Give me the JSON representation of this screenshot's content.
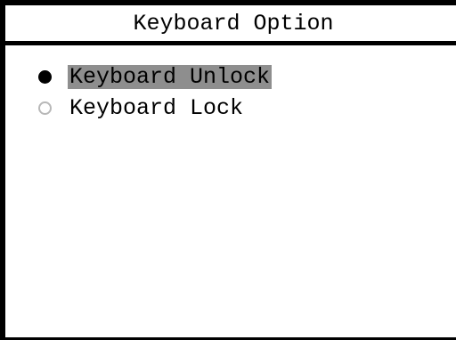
{
  "dialog": {
    "title": "Keyboard Option"
  },
  "options": [
    {
      "label": "Keyboard Unlock",
      "selected": true
    },
    {
      "label": "Keyboard Lock",
      "selected": false
    }
  ],
  "colors": {
    "border": "#000000",
    "highlight": "#8e8e8e",
    "radio_unselected": "#b8b8b8"
  }
}
